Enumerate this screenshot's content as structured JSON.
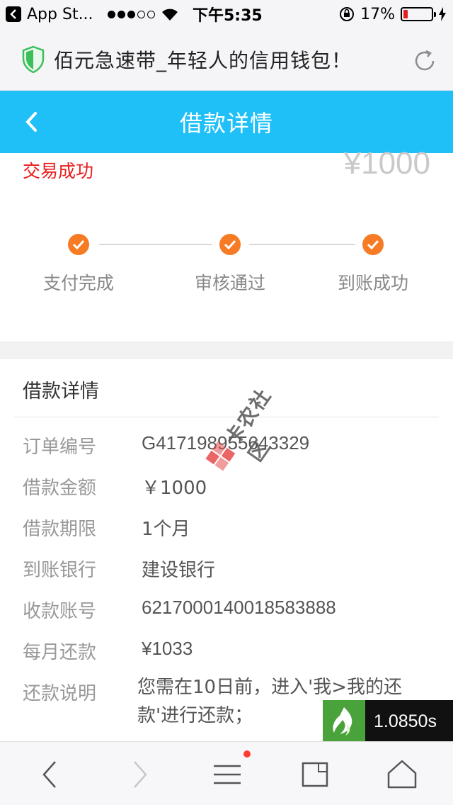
{
  "status_bar": {
    "back_app": "App St...",
    "time": "下午5:35",
    "battery": "17%",
    "battery_level": 0.17,
    "battery_color": "#e61e1e"
  },
  "browser": {
    "page_title": "佰元急速带_年轻人的信用钱包！"
  },
  "header": {
    "title": "借款详情",
    "accent": "#1ec0f7"
  },
  "summary": {
    "status": "交易成功",
    "amount": "¥1000",
    "status_color": "#e81c1c"
  },
  "steps": [
    {
      "label": "支付完成"
    },
    {
      "label": "审核通过"
    },
    {
      "label": "到账成功"
    }
  ],
  "step_color": "#f77b24",
  "details": {
    "title": "借款详情",
    "rows": [
      {
        "key": "订单编号",
        "value": "G417198955643329"
      },
      {
        "key": "借款金额",
        "value": "￥1000"
      },
      {
        "key": "借款期限",
        "value": "1个月"
      },
      {
        "key": "到账银行",
        "value": "建设银行"
      },
      {
        "key": "收款账号",
        "value": "6217000140018583888"
      },
      {
        "key": "每月还款",
        "value": "¥1033"
      },
      {
        "key": "还款说明",
        "value": "您需在10日前，进入'我>我的还款'进行还款；"
      }
    ]
  },
  "watermark": {
    "text": "卡农社区"
  },
  "float_widget": {
    "value": "1.0850s"
  }
}
